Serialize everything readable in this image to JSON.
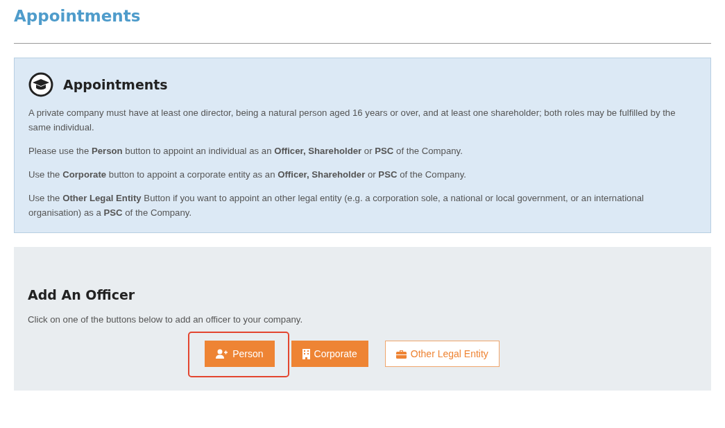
{
  "page_title": "Appointments",
  "info": {
    "title": "Appointments",
    "paragraphs": [
      "A private company must have at least one director, being a natural person aged 16 years or over, and at least one shareholder; both roles may be fulfilled by the same individual.",
      "Please use the **Person** button to appoint an individual as an **Officer, Shareholder** or **PSC** of the Company.",
      "Use the **Corporate** button to appoint a corporate entity as an **Officer, Shareholder** or **PSC** of the Company.",
      "Use the **Other Legal Entity** Button if you want to appoint an other legal entity (e.g. a corporation sole, a national or local government, or an international organisation) as a **PSC** of the Company."
    ]
  },
  "officer": {
    "title": "Add An Officer",
    "description": "Click on one of the buttons below to add an officer to your company.",
    "buttons": [
      {
        "label": "Person",
        "kind": "solid",
        "highlighted": true
      },
      {
        "label": "Corporate",
        "kind": "solid",
        "highlighted": false
      },
      {
        "label": "Other Legal Entity",
        "kind": "outline",
        "highlighted": false
      }
    ]
  }
}
